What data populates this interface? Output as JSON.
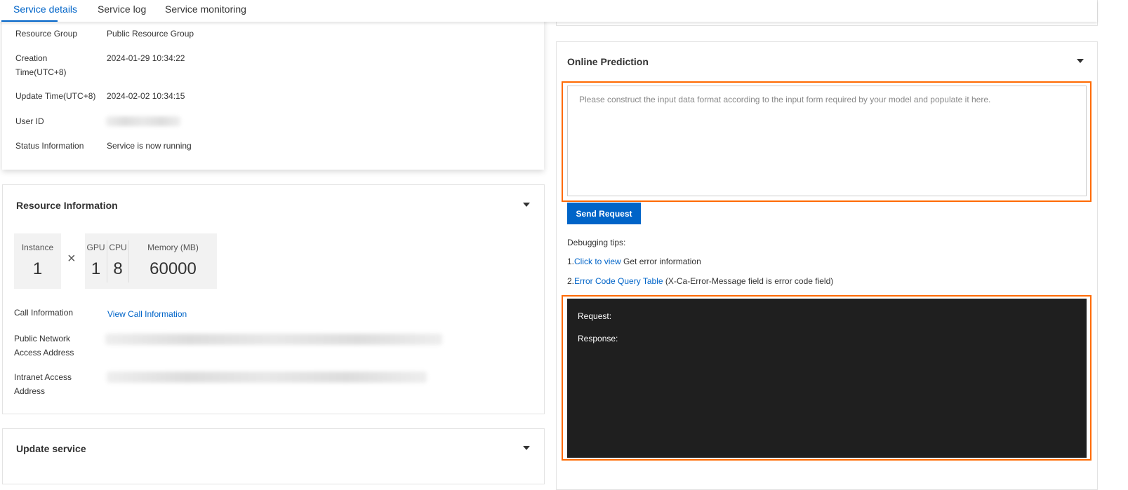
{
  "tabs": [
    {
      "label": "Service details",
      "active": true
    },
    {
      "label": "Service log"
    },
    {
      "label": "Service monitoring"
    }
  ],
  "basic_info": {
    "resource_group_label": "Resource Group",
    "resource_group": "Public Resource Group",
    "creation_label_1": "Creation",
    "creation_label_2": "Time(UTC+8)",
    "creation_time": "2024-01-29 10:34:22",
    "update_label": "Update Time(UTC+8)",
    "update_time": "2024-02-02 10:34:15",
    "user_id_label": "User ID",
    "status_label": "Status Information",
    "status": "Service is now running"
  },
  "resource": {
    "title": "Resource Information",
    "instance_label": "Instance",
    "instance": "1",
    "times": "×",
    "gpu_label": "GPU",
    "gpu": "1",
    "cpu_label": "CPU",
    "cpu": "8",
    "memory_label": "Memory (MB)",
    "memory": "60000",
    "call_info_label": "Call Information",
    "call_info_link": "View Call Information",
    "public_label_1": "Public Network",
    "public_label_2": "Access Address",
    "intranet_label_1": "Intranet Access",
    "intranet_label_2": "Address"
  },
  "update_service": {
    "title": "Update service"
  },
  "prediction": {
    "title": "Online Prediction",
    "placeholder": "Please construct the input data format according to the input form required by your model and populate it here.",
    "send_label": "Send Request",
    "tips_title": "Debugging tips:",
    "tip1_prefix": "1.",
    "tip1_link": "Click to view",
    "tip1_text": " Get error information",
    "tip2_prefix": "2.",
    "tip2_link": "Error Code Query Table",
    "tip2_text": " (X-Ca-Error-Message field is error code field)",
    "request_label": "Request:",
    "response_label": "Response:"
  },
  "colors": {
    "accent": "#0064c8",
    "highlight": "#ff6a00",
    "console": "#1f1f1f"
  }
}
